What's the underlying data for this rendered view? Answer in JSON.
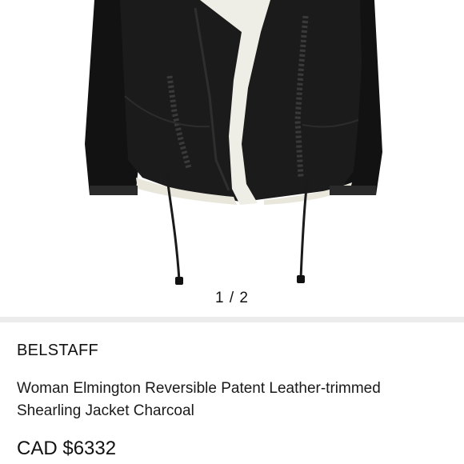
{
  "gallery": {
    "pager_text": "1 / 2",
    "current_index": 1,
    "total": 2,
    "image_subject": "black leather shearling jacket"
  },
  "product": {
    "brand": "BELSTAFF",
    "title": "Woman Elmington Reversible Patent Leather-trimmed Shearling Jacket Charcoal",
    "price": "CAD $6332"
  },
  "colors": {
    "leather": "#141414",
    "shearling": "#efeee6",
    "divider": "#ececec",
    "text": "#1a1a1a"
  }
}
